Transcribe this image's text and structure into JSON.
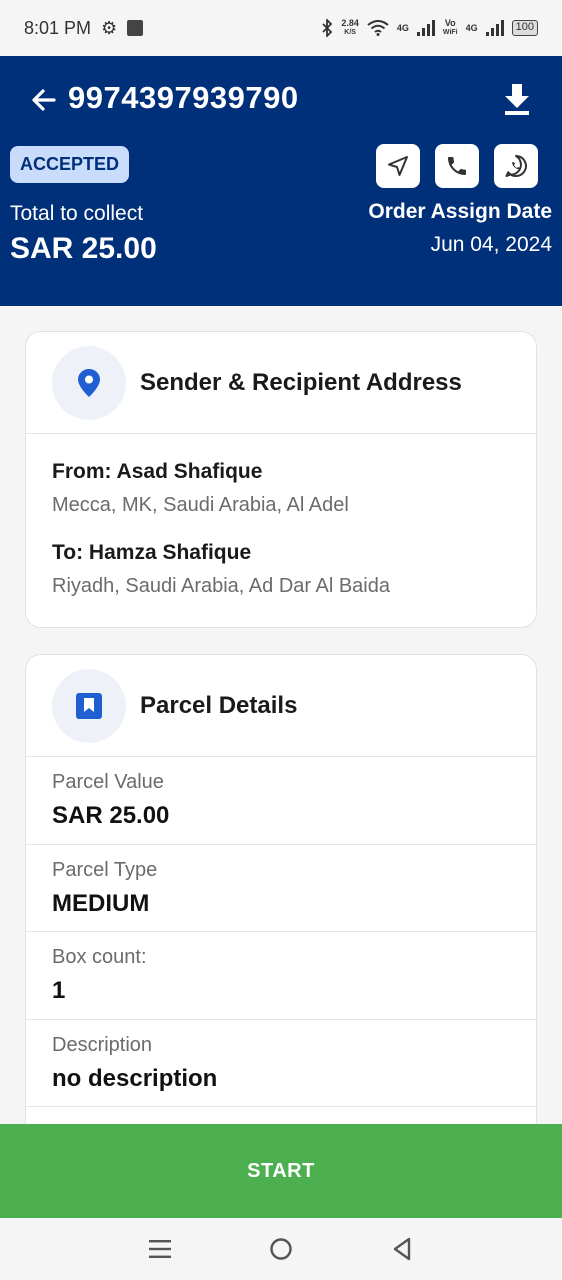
{
  "status_bar": {
    "time": "8:01 PM",
    "net_speed_value": "2.84",
    "net_speed_unit": "K/S",
    "net_type_1": "4G",
    "volte_top": "Vo",
    "volte_bottom": "WiFi",
    "net_type_2": "4G",
    "battery": "100"
  },
  "header": {
    "order_id": "9974397939790",
    "status_badge": "ACCEPTED",
    "collect_label": "Total to collect",
    "collect_amount": "SAR 25.00",
    "assign_label": "Order Assign Date",
    "assign_date": "Jun 04, 2024"
  },
  "address_card": {
    "title": "Sender & Recipient Address",
    "from_name": "From: Asad Shafique",
    "from_address": "Mecca, MK, Saudi Arabia, Al Adel",
    "to_name": "To: Hamza Shafique",
    "to_address": "Riyadh, Saudi Arabia, Ad Dar Al Baida"
  },
  "parcel_card": {
    "title": "Parcel Details",
    "rows": [
      {
        "label": "Parcel Value",
        "value": "SAR 25.00"
      },
      {
        "label": "Parcel Type",
        "value": "MEDIUM"
      },
      {
        "label": "Box count:",
        "value": "1"
      },
      {
        "label": "Description",
        "value": "no description"
      }
    ]
  },
  "start_button": "START",
  "colors": {
    "header_bg": "#00307a",
    "badge_bg": "#c9dcfb",
    "accent_blue": "#1f5fd1",
    "start_green": "#4caf50"
  }
}
